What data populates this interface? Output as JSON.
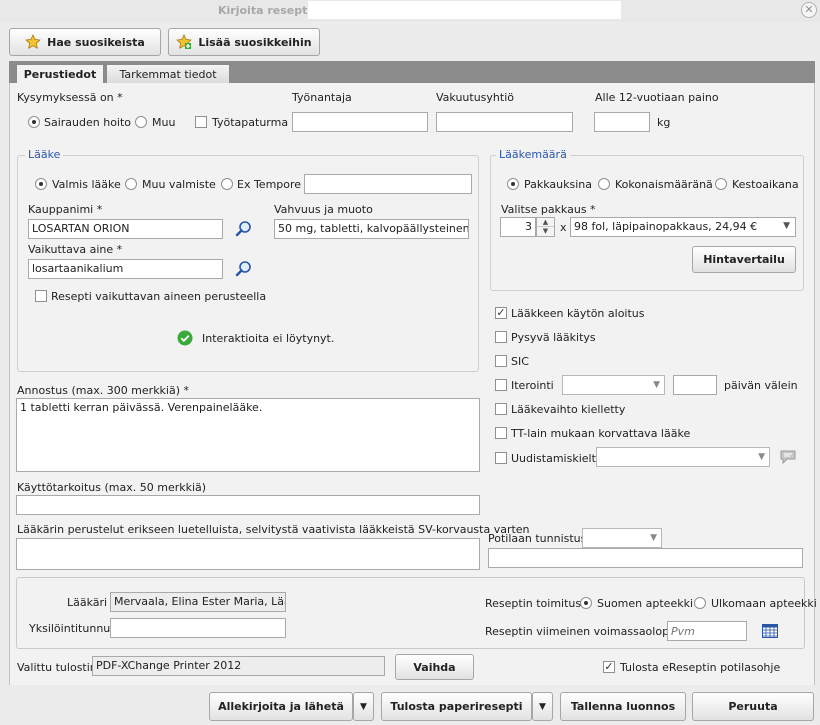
{
  "window": {
    "title": "Kirjoita resepti -",
    "close_glyph": "✕"
  },
  "toolbar": {
    "fetch_favorites": "Hae suosikeista",
    "add_favorites": "Lisää suosikkeihin"
  },
  "tabs": [
    "Perustiedot",
    "Tarkemmat tiedot"
  ],
  "case": {
    "label": "Kysymyksessä on *",
    "options": [
      "Sairauden hoito",
      "Muu"
    ],
    "accident_label": "Työtapaturma",
    "employer_label": "Työnantaja",
    "employer_value": "",
    "insurer_label": "Vakuutusyhtiö",
    "insurer_value": "",
    "weight_label": "Alle 12-vuotiaan paino",
    "weight_value": "",
    "weight_unit": "kg"
  },
  "drug": {
    "group_label": "Lääke",
    "type_options": [
      "Valmis lääke",
      "Muu valmiste",
      "Ex Tempore"
    ],
    "ex_tempore_value": "",
    "trade_name_label": "Kauppanimi *",
    "trade_name_value": "LOSARTAN ORION",
    "strength_label": "Vahvuus ja muoto",
    "strength_value": "50 mg, tabletti, kalvopäällysteinen",
    "active_label": "Vaikuttava aine *",
    "active_value": "losartaanikalium",
    "by_active_label": "Resepti vaikuttavan aineen perusteella",
    "interactions_text": "Interaktioita ei löytynyt."
  },
  "amount": {
    "group_label": "Lääkemäärä",
    "options": [
      "Pakkauksina",
      "Kokonaismääränä",
      "Kestoaikana"
    ],
    "pack_label": "Valitse pakkaus *",
    "quantity": "3",
    "times": "x",
    "pack_value": "98 fol, läpipainopakkaus, 24,94 €",
    "price_compare": "Hintavertailu"
  },
  "options": {
    "start": "Lääkkeen käytön aloitus",
    "permanent": "Pysyvä lääkitys",
    "sic": "SIC",
    "iteration": "Iterointi",
    "iteration_days_value": "",
    "iteration_suffix": "päivän välein",
    "no_substitution": "Lääkevaihto kielletty",
    "tt_law": "TT-lain mukaan korvattava lääke",
    "renewal_ban": "Uudistamiskielto"
  },
  "dosage": {
    "label": "Annostus (max. 300 merkkiä) *",
    "value": "1 tabletti kerran päivässä. Verenpainelääke."
  },
  "purpose": {
    "label": "Käyttötarkoitus (max. 50 merkkiä)",
    "value": ""
  },
  "justification": {
    "label": "Lääkärin perustelut erikseen luetelluista, selvitystä vaativista lääkkeistä SV-korvausta varten",
    "value": ""
  },
  "patient_id": {
    "label": "Potilaan tunnistus",
    "value": ""
  },
  "doctor": {
    "label": "Lääkäri",
    "value": "Mervaala, Elina Ester Maria, Lääkäri",
    "id_label": "Yksilöintitunnus",
    "id_value": ""
  },
  "delivery": {
    "label": "Reseptin toimitus",
    "options": [
      "Suomen apteekki",
      "Ulkomaan apteekki"
    ],
    "validity_label": "Reseptin viimeinen voimassaolopäivä",
    "validity_placeholder": "Pvm"
  },
  "printer": {
    "label": "Valittu tulostin",
    "value": "PDF-XChange Printer 2012",
    "change": "Vaihda",
    "patient_guide": "Tulosta eReseptin potilasohje"
  },
  "footer": {
    "sign_send": "Allekirjoita ja lähetä",
    "print_paper": "Tulosta paperiresepti",
    "save_draft": "Tallenna luonnos",
    "cancel": "Peruuta"
  },
  "checked_glyph": "✓",
  "colors": {
    "group_title": "#2a56a8",
    "ok_green": "#3aab3a",
    "star": "#f2c230"
  }
}
